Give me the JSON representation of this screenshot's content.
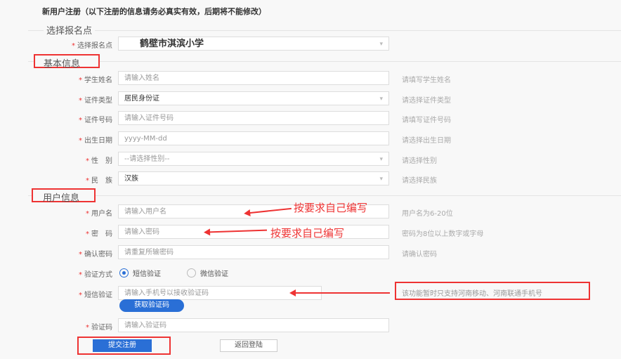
{
  "title": "新用户注册（以下注册的信息请务必真实有效，后期将不能修改）",
  "sections": {
    "site": "选择报名点",
    "basic": "基本信息",
    "user": "用户信息"
  },
  "site": {
    "label": "选择报名点",
    "value": "鹤壁市淇滨小学"
  },
  "basic": [
    {
      "label": "学生姓名",
      "placeholder": "请输入姓名",
      "hint": "请填写学生姓名"
    },
    {
      "label": "证件类型",
      "value": "居民身份证",
      "hint": "请选择证件类型"
    },
    {
      "label": "证件号码",
      "placeholder": "请输入证件号码",
      "hint": "请填写证件号码"
    },
    {
      "label": "出生日期",
      "placeholder": "yyyy-MM-dd",
      "hint": "请选择出生日期"
    },
    {
      "label": "性　别",
      "placeholder": "--请选择性别--",
      "hint": "请选择性别"
    },
    {
      "label": "民　族",
      "value": "汉族",
      "hint": "请选择民族"
    }
  ],
  "user": {
    "username": {
      "label": "用户名",
      "placeholder": "请输入用户名",
      "hint": "用户名为6-20位"
    },
    "password": {
      "label": "密　码",
      "placeholder": "请输入密码",
      "hint": "密码为8位以上数字或字母"
    },
    "confirm": {
      "label": "确认密码",
      "placeholder": "请重复所输密码",
      "hint": "请确认密码"
    },
    "verify_method": {
      "label": "验证方式",
      "options": [
        "短信验证",
        "微信验证"
      ],
      "selected": "短信验证"
    },
    "sms": {
      "label": "短信验证",
      "placeholder": "请输入手机号以接收验证码",
      "hint": "该功能暂时只支持河南移动、河南联通手机号",
      "get_code": "获取验证码"
    },
    "code": {
      "label": "验证码",
      "placeholder": "请输入验证码"
    }
  },
  "buttons": {
    "submit": "提交注册",
    "back": "返回登陆"
  },
  "annotations": {
    "note1": "按要求自己编写",
    "note2": "按要求自己编写"
  }
}
